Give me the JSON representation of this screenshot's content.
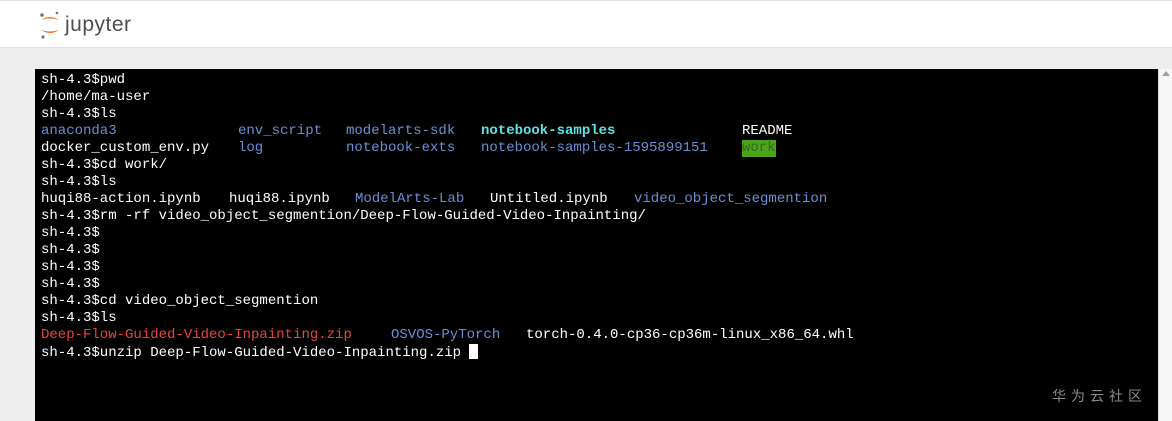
{
  "header": {
    "app_name": "jupyter",
    "logo_colors": {
      "orange": "#f37726",
      "gray": "#767677"
    }
  },
  "terminal": {
    "colors": {
      "directory": "#6b8fd6",
      "cyan": "#5ee3e3",
      "archive": "#e8453c",
      "highlight_bg": "#4aa51c"
    },
    "lines": {
      "l1": "sh-4.3$pwd",
      "l2": "/home/ma-user",
      "l3": "sh-4.3$ls",
      "l4": {
        "c1": "anaconda3",
        "c2": "env_script",
        "c3": "modelarts-sdk",
        "c4": "notebook-samples",
        "c5": "README"
      },
      "l5": {
        "c1": "docker_custom_env.py",
        "c2": "log",
        "c3": "notebook-exts",
        "c4": "notebook-samples-1595899151",
        "c5": "work"
      },
      "l6": "sh-4.3$cd work/",
      "l7": "sh-4.3$ls",
      "l8": {
        "c1": "huqi88-action.ipynb",
        "c2": "huqi88.ipynb",
        "c3": "ModelArts-Lab",
        "c4": "Untitled.ipynb",
        "c5": "video_object_segmention"
      },
      "l9": "sh-4.3$rm -rf video_object_segmention/Deep-Flow-Guided-Video-Inpainting/",
      "l10": "sh-4.3$",
      "l11": "sh-4.3$",
      "l12": "sh-4.3$",
      "l13": "sh-4.3$",
      "l14": "sh-4.3$cd video_object_segmention",
      "l15": "sh-4.3$ls",
      "l16": {
        "c1": "Deep-Flow-Guided-Video-Inpainting.zip",
        "c2": "OSVOS-PyTorch",
        "c3": "torch-0.4.0-cp36-cp36m-linux_x86_64.whl"
      },
      "l17": "sh-4.3$unzip Deep-Flow-Guided-Video-Inpainting.zip "
    }
  },
  "watermark": "华为云社区"
}
